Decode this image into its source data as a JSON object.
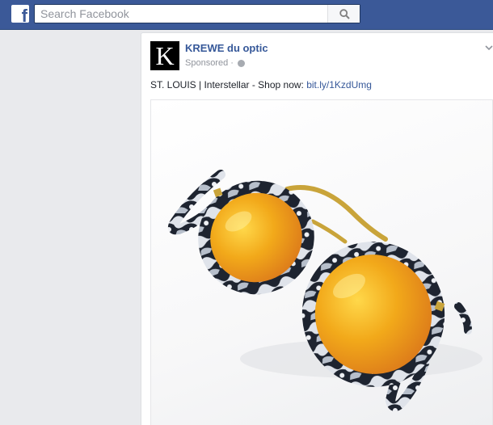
{
  "topbar": {
    "logo_glyph": "f",
    "search_placeholder": "Search Facebook",
    "icons": [
      "facebook-logo-icon",
      "search-icon"
    ],
    "brand_color": "#3b5998"
  },
  "post": {
    "page_name": "KREWE du optic",
    "avatar_letter": "K",
    "sponsored_label": "Sponsored",
    "meta_separator": "·",
    "text": "ST. LOUIS | Interstellar - Shop now: ",
    "link": "bit.ly/1KzdUmg",
    "link_color": "#365899",
    "icons": [
      "globe-icon",
      "chevron-down-icon"
    ],
    "image_subject": "sunglasses-with-orange-mirrored-lenses-and-marble-frames"
  }
}
